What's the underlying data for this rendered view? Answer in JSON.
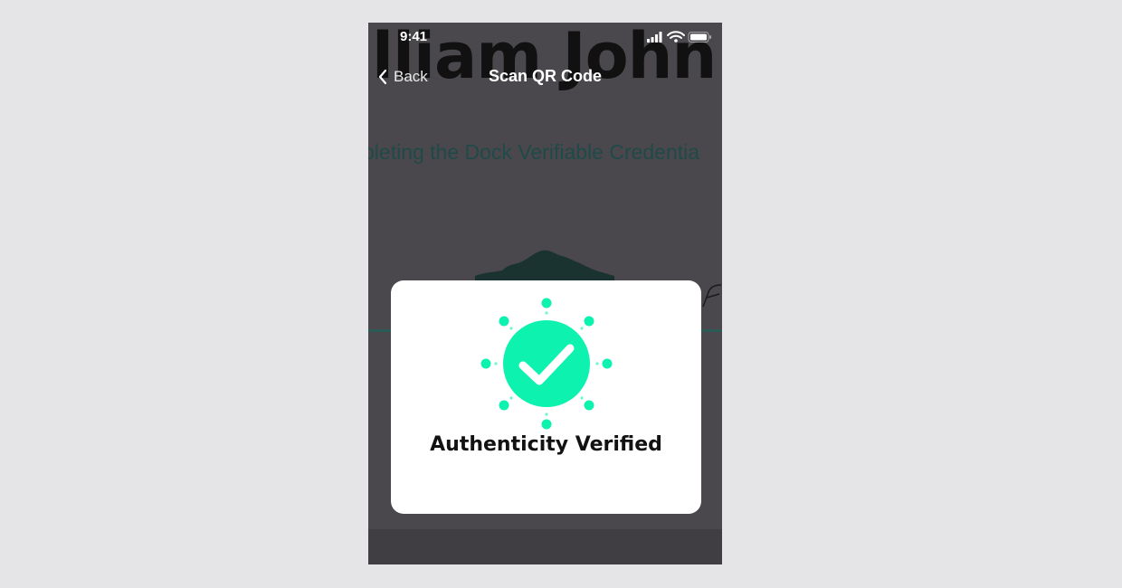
{
  "status_bar": {
    "time": "9:41",
    "icons": [
      "signal-icon",
      "wifi-icon",
      "battery-icon"
    ]
  },
  "nav": {
    "back_label": "Back",
    "title": "Scan QR Code"
  },
  "background": {
    "name_text": "lliam John",
    "subtitle_text": "pleting the Dock Verifiable Credentia"
  },
  "modal": {
    "title": "Authenticity Verified",
    "icon": "check-circle-icon"
  },
  "colors": {
    "accent": "#0ef2b0",
    "overlay": "#4a484c",
    "card": "#ffffff"
  }
}
